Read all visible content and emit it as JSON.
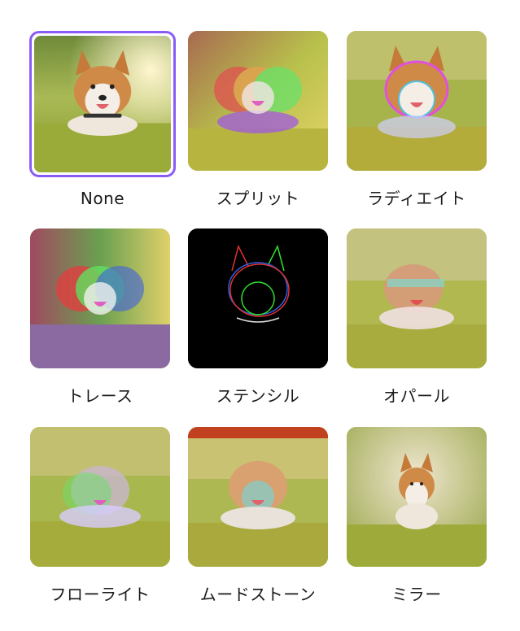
{
  "filters": [
    {
      "label": "None",
      "selected": true,
      "effect": "none"
    },
    {
      "label": "スプリット",
      "selected": false,
      "effect": "split"
    },
    {
      "label": "ラディエイト",
      "selected": false,
      "effect": "radiate"
    },
    {
      "label": "トレース",
      "selected": false,
      "effect": "trace"
    },
    {
      "label": "ステンシル",
      "selected": false,
      "effect": "stencil"
    },
    {
      "label": "オパール",
      "selected": false,
      "effect": "opal"
    },
    {
      "label": "フローライト",
      "selected": false,
      "effect": "flowlight"
    },
    {
      "label": "ムードストーン",
      "selected": false,
      "effect": "moodstone"
    },
    {
      "label": "ミラー",
      "selected": false,
      "effect": "mirror"
    }
  ],
  "colors": {
    "selection_border": "#8a5cf6"
  }
}
